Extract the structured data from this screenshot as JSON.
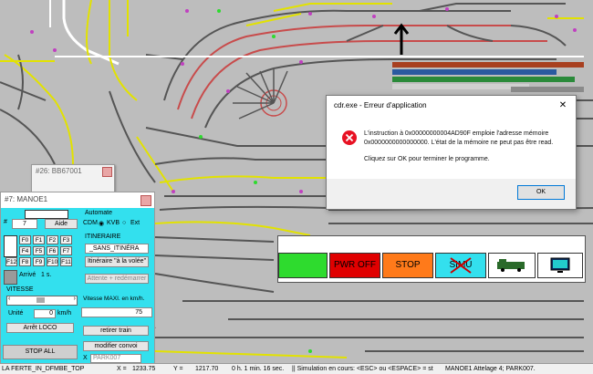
{
  "window_small": {
    "title": "#26: BB67001"
  },
  "manoeuvre": {
    "title": "#7: MANOE1",
    "loco_number": "7",
    "aide_label": "Aide",
    "functions": [
      "F0",
      "F1",
      "F2",
      "F3",
      "F4",
      "F5",
      "F6",
      "F7",
      "F8",
      "F9",
      "F10",
      "F11",
      "F12"
    ],
    "arrive_label": "Arrivé",
    "arrive_value": "1 s.",
    "vitesse_label": "VITESSE",
    "unite_label": "Unité",
    "speed_value": "0",
    "speed_unit": "km/h",
    "arret_label": "Arrêt LOCO",
    "stop_all_label": "STOP ALL",
    "automate_label": "Automate",
    "cdm_label": "CDM",
    "kvb_label": "KVB",
    "ext_label": "Ext",
    "itineraire_label": "ITINERAIRE",
    "itineraire_value": "_SANS_ITINÉRA",
    "itineraire_volee": "Itinéraire \"à la volée\"",
    "attente_label": "Attente + redémarrer",
    "vmax_label": "Vitesse MAXI. en km/h.",
    "vmax_value": "75",
    "retirer_label": "retirer train",
    "modifier_label": "modifier convoi",
    "x_label": "X",
    "park_value": "PARK007"
  },
  "dialog": {
    "title": "cdr.exe - Erreur d'application",
    "message_line1": "L'instruction à 0x00000000004AD90F emploie l'adresse mémoire",
    "message_line2": "0x0000000000000000. L'état de la mémoire ne peut pas être read.",
    "message_line3": "Cliquez sur OK pour terminer le programme.",
    "ok_label": "OK",
    "close_glyph": "✕"
  },
  "actions": {
    "pwr_off": "PWR OFF",
    "stop": "STOP",
    "simu": "SIMU"
  },
  "status": {
    "left_text": "LA FERTE_IN_DFMBE_TOP",
    "x_label": "X =",
    "x_value": "1233.75",
    "y_label": "Y =",
    "y_value": "1217.70",
    "time": "0 h. 1 min. 16 sec.",
    "sim_text": "|| Simulation en cours: <ESC> ou <ESPACE> = st",
    "train_text": "MANOE1 Attelage 4; PARK007."
  },
  "colors": {
    "green": "#2edb2e",
    "red": "#e00000",
    "orange": "#ff7a1a",
    "cyan": "#33e0ee",
    "track": "#555555",
    "track_red": "#c84b4b",
    "track_yellow": "#e2e200"
  }
}
